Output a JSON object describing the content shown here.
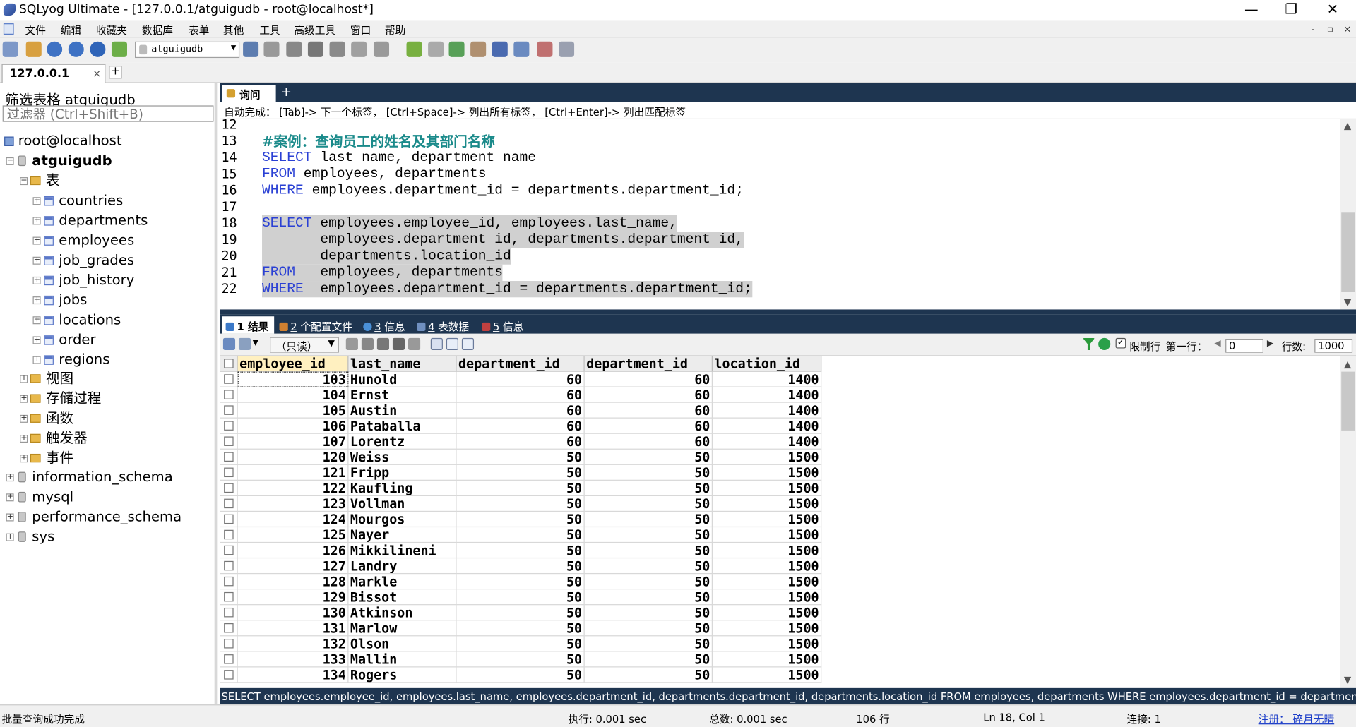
{
  "window": {
    "title": "SQLyog Ultimate - [127.0.0.1/atguigudb - root@localhost*]",
    "minimize": "—",
    "maximize": "❐",
    "close": "✕"
  },
  "menu": [
    "文件",
    "编辑",
    "收藏夹",
    "数据库",
    "表单",
    "其他",
    "工具",
    "高级工具",
    "窗口",
    "帮助"
  ],
  "mdi": {
    "minimize": "-",
    "restore": "▫",
    "close": "×"
  },
  "toolbar": {
    "database_selected": "atguigudb"
  },
  "connection_tab": {
    "label": "127.0.0.1",
    "close": "×",
    "add": "+"
  },
  "left": {
    "filter_label": "筛选表格 atguigudb",
    "filter_placeholder": "过滤器 (Ctrl+Shift+B)",
    "root": "root@localhost",
    "db": "atguigudb",
    "tables_folder": "表",
    "tables": [
      "countries",
      "departments",
      "employees",
      "job_grades",
      "job_history",
      "jobs",
      "locations",
      "order",
      "regions"
    ],
    "folders": [
      "视图",
      "存储过程",
      "函数",
      "触发器",
      "事件"
    ],
    "other_dbs": [
      "information_schema",
      "mysql",
      "performance_schema",
      "sys"
    ]
  },
  "query_tab": {
    "label": "询问",
    "add": "+"
  },
  "autocomplete": "自动完成： [Tab]-> 下一个标签， [Ctrl+Space]-> 列出所有标签， [Ctrl+Enter]-> 列出匹配标签",
  "editor": {
    "lines": [
      {
        "n": "12",
        "k": "",
        "t": ""
      },
      {
        "n": "13",
        "k": "",
        "t": "",
        "comment": "#案例：查询员工的姓名及其部门名称"
      },
      {
        "n": "14",
        "k": "SELECT",
        "t": " last_name, department_name"
      },
      {
        "n": "15",
        "k": "FROM",
        "t": " employees, departments"
      },
      {
        "n": "16",
        "k": "WHERE",
        "t": " employees.department_id = departments.department_id;"
      },
      {
        "n": "17",
        "k": "",
        "t": ""
      },
      {
        "n": "18",
        "k": "SELECT",
        "t": " employees.employee_id, employees.last_name,"
      },
      {
        "n": "19",
        "k": "",
        "t": "       employees.department_id, departments.department_id,"
      },
      {
        "n": "20",
        "k": "",
        "t": "       departments.location_id"
      },
      {
        "n": "21",
        "k": "FROM",
        "t": "   employees, departments"
      },
      {
        "n": "22",
        "k": "WHERE",
        "t": "  employees.department_id = departments.department_id;"
      }
    ]
  },
  "result_tabs": [
    {
      "num": "1",
      "label": "结果",
      "color": "#3a78c8"
    },
    {
      "num": "2",
      "label": "个配置文件",
      "color": "#d08030"
    },
    {
      "num": "3",
      "label": "信息",
      "color": "#4a90d8"
    },
    {
      "num": "4",
      "label": "表数据",
      "color": "#7090c0"
    },
    {
      "num": "5",
      "label": "信息",
      "color": "#c04040"
    }
  ],
  "result_toolbar": {
    "readonly": "（只读）",
    "limit_label": "限制行",
    "first_row_label": "第一行：",
    "first_row": "0",
    "rows_label": "行数:",
    "rows": "1000"
  },
  "grid": {
    "columns": [
      "employee_id",
      "last_name",
      "department_id",
      "department_id",
      "location_id"
    ],
    "rows": [
      [
        "103",
        "Hunold",
        "60",
        "60",
        "1400"
      ],
      [
        "104",
        "Ernst",
        "60",
        "60",
        "1400"
      ],
      [
        "105",
        "Austin",
        "60",
        "60",
        "1400"
      ],
      [
        "106",
        "Pataballa",
        "60",
        "60",
        "1400"
      ],
      [
        "107",
        "Lorentz",
        "60",
        "60",
        "1400"
      ],
      [
        "120",
        "Weiss",
        "50",
        "50",
        "1500"
      ],
      [
        "121",
        "Fripp",
        "50",
        "50",
        "1500"
      ],
      [
        "122",
        "Kaufling",
        "50",
        "50",
        "1500"
      ],
      [
        "123",
        "Vollman",
        "50",
        "50",
        "1500"
      ],
      [
        "124",
        "Mourgos",
        "50",
        "50",
        "1500"
      ],
      [
        "125",
        "Nayer",
        "50",
        "50",
        "1500"
      ],
      [
        "126",
        "Mikkilineni",
        "50",
        "50",
        "1500"
      ],
      [
        "127",
        "Landry",
        "50",
        "50",
        "1500"
      ],
      [
        "128",
        "Markle",
        "50",
        "50",
        "1500"
      ],
      [
        "129",
        "Bissot",
        "50",
        "50",
        "1500"
      ],
      [
        "130",
        "Atkinson",
        "50",
        "50",
        "1500"
      ],
      [
        "131",
        "Marlow",
        "50",
        "50",
        "1500"
      ],
      [
        "132",
        "Olson",
        "50",
        "50",
        "1500"
      ],
      [
        "133",
        "Mallin",
        "50",
        "50",
        "1500"
      ],
      [
        "134",
        "Rogers",
        "50",
        "50",
        "1500"
      ]
    ]
  },
  "sql_echo": "SELECT employees.employee_id, employees.last_name, employees.department_id, departments.department_id, departments.location_id FROM employees, departments WHERE employees.department_id = department...",
  "status": {
    "left": "批量查询成功完成",
    "exec": "执行: 0.001 sec",
    "total": "总数: 0.001 sec",
    "rows": "106 行",
    "pos": "Ln 18, Col 1",
    "conn": "连接: 1",
    "register": "注册： 碎月无晴"
  }
}
